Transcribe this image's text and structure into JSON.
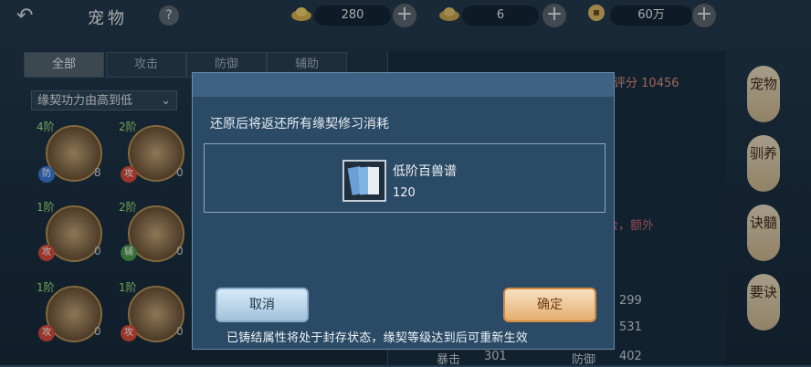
{
  "header": {
    "title": "宠物",
    "back_icon": "back-arrow-icon",
    "help_icon": "question-icon",
    "resources": [
      {
        "icon": "gold-ingot-icon",
        "value": "280"
      },
      {
        "icon": "silver-ingot-icon",
        "value": "6"
      },
      {
        "icon": "coin-icon",
        "value": "60万"
      }
    ]
  },
  "tabs": [
    {
      "label": "全部",
      "active": true
    },
    {
      "label": "攻击",
      "active": false
    },
    {
      "label": "防御",
      "active": false
    },
    {
      "label": "辅助",
      "active": false
    }
  ],
  "sort": {
    "label": "缘契功力由高到低"
  },
  "pets": [
    {
      "grade": "4阶",
      "badge": "防",
      "count": "8"
    },
    {
      "grade": "2阶",
      "badge": "攻",
      "count": "0"
    },
    {
      "grade": "1阶",
      "badge": "攻",
      "count": "0"
    },
    {
      "grade": "2阶",
      "badge": "辅",
      "count": "0"
    },
    {
      "grade": "1阶",
      "badge": "攻",
      "count": "0"
    },
    {
      "grade": "1阶",
      "badge": "攻",
      "count": "0"
    }
  ],
  "right_panel": {
    "score_label": "评分",
    "score_value": "10456",
    "partial_text": "会，额外",
    "stats": [
      {
        "label": "",
        "value": "299"
      },
      {
        "label": "",
        "value": "531"
      },
      {
        "label": "暴击",
        "value": "301"
      },
      {
        "label": "防御",
        "value": "402"
      }
    ]
  },
  "side_tabs": [
    "宠物",
    "驯养",
    "诀髓",
    "要诀"
  ],
  "modal": {
    "message": "还原后将返还所有缘契修习消耗",
    "item": {
      "name": "低阶百兽谱",
      "quantity": "120",
      "icon": "book-icon"
    },
    "cancel_label": "取消",
    "confirm_label": "确定",
    "footer": "已铸结属性将处于封存状态，缘契等级达到后可重新生效"
  },
  "colors": {
    "accent_ok": "#e5ae6f",
    "accent_cancel": "#a3c2db",
    "modal_bg": "#2b4a66"
  }
}
